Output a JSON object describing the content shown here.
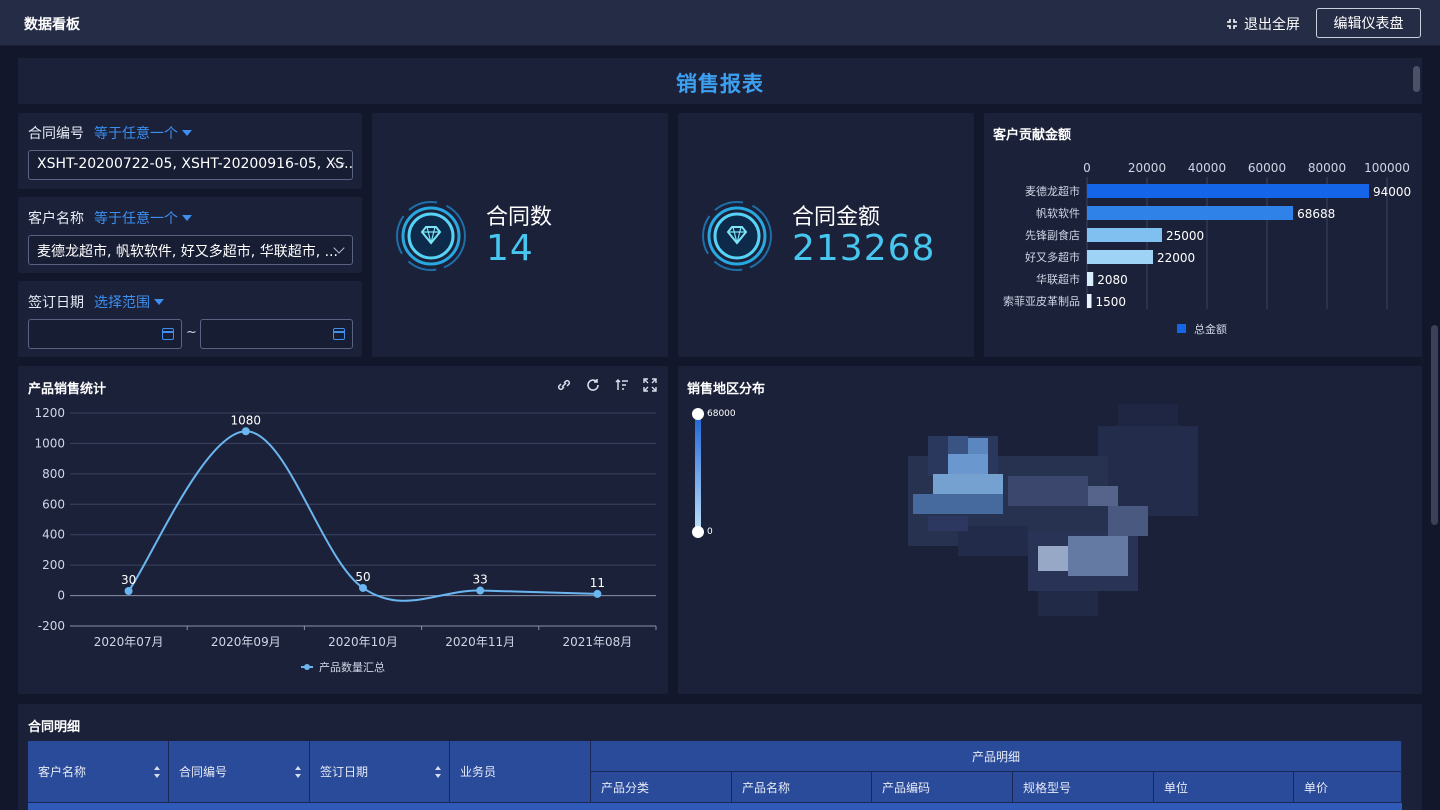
{
  "header": {
    "title": "数据看板",
    "exit_label": "退出全屏",
    "edit_label": "编辑仪表盘"
  },
  "report": {
    "title": "销售报表"
  },
  "filters": {
    "contract": {
      "label": "合同编号",
      "op": "等于任意一个",
      "value": "XSHT-20200722-05, XSHT-20200916-05, XS..."
    },
    "customer": {
      "label": "客户名称",
      "op": "等于任意一个",
      "value": "麦德龙超市, 帆软软件, 好又多超市, 华联超市, ..."
    },
    "date": {
      "label": "签订日期",
      "op": "选择范围",
      "separator": "~"
    }
  },
  "kpis": [
    {
      "label": "合同数",
      "value": "14"
    },
    {
      "label": "合同金额",
      "value": "213268"
    }
  ],
  "customer_chart": {
    "title": "客户贡献金额",
    "legend": "总金额",
    "chart_data": {
      "type": "bar",
      "orientation": "horizontal",
      "categories": [
        "麦德龙超市",
        "帆软软件",
        "先锋副食店",
        "好又多超市",
        "华联超市",
        "索菲亚皮革制品"
      ],
      "values": [
        94000,
        68688,
        25000,
        22000,
        2080,
        1500
      ],
      "xlim": [
        0,
        100000
      ],
      "ticks": [
        "0",
        "20000",
        "40000",
        "60000",
        "80000",
        "100000"
      ],
      "axis_position": "top",
      "legend_position": "bottom",
      "colors": [
        "#1565e8",
        "#2f82e8",
        "#7fc0f0",
        "#9fd3f6",
        "#d8eefc",
        "#e8f5fe"
      ]
    }
  },
  "product_chart": {
    "title": "产品销售统计",
    "legend": "产品数量汇总",
    "chart_data": {
      "type": "line",
      "smooth": true,
      "categories": [
        "2020年07月",
        "2020年09月",
        "2020年10月",
        "2020年11月",
        "2021年08月"
      ],
      "values": [
        30,
        1080,
        50,
        33,
        11
      ],
      "ylim": [
        -200,
        1200
      ],
      "yticks": [
        "1200",
        "1000",
        "800",
        "600",
        "400",
        "200",
        "0",
        "-200"
      ],
      "grid": true,
      "legend_position": "bottom",
      "color": "#6bb6f0"
    }
  },
  "map": {
    "title": "销售地区分布",
    "range_max": "68000",
    "range_min": "0"
  },
  "table": {
    "title": "合同明细",
    "columns": [
      "客户名称",
      "合同编号",
      "签订日期",
      "业务员"
    ],
    "group_header": "产品明细",
    "sub_columns": [
      "产品分类",
      "产品名称",
      "产品编码",
      "规格型号",
      "单位",
      "单价"
    ]
  }
}
